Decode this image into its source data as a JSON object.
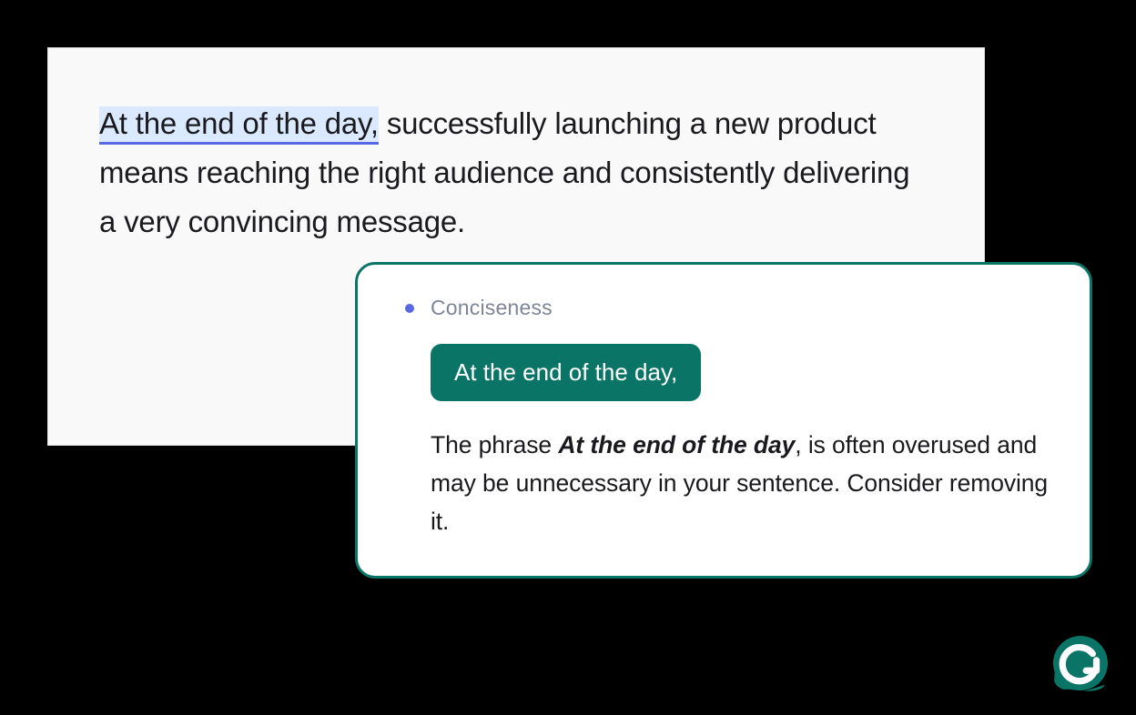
{
  "editor": {
    "highlighted_phrase": "At the end of the day,",
    "remaining_text": " successfully launching a new product means reaching the right audience and consistently delivering a very convincing message."
  },
  "suggestion": {
    "category": "Conciseness",
    "chip_text": "At the end of the day,",
    "desc_prefix": "The phrase ",
    "desc_bold": "At the end of the day",
    "desc_suffix": ", is often overused and may be unnecessary in your sentence. Consider removing it."
  },
  "logo": {
    "name": "grammarly"
  }
}
